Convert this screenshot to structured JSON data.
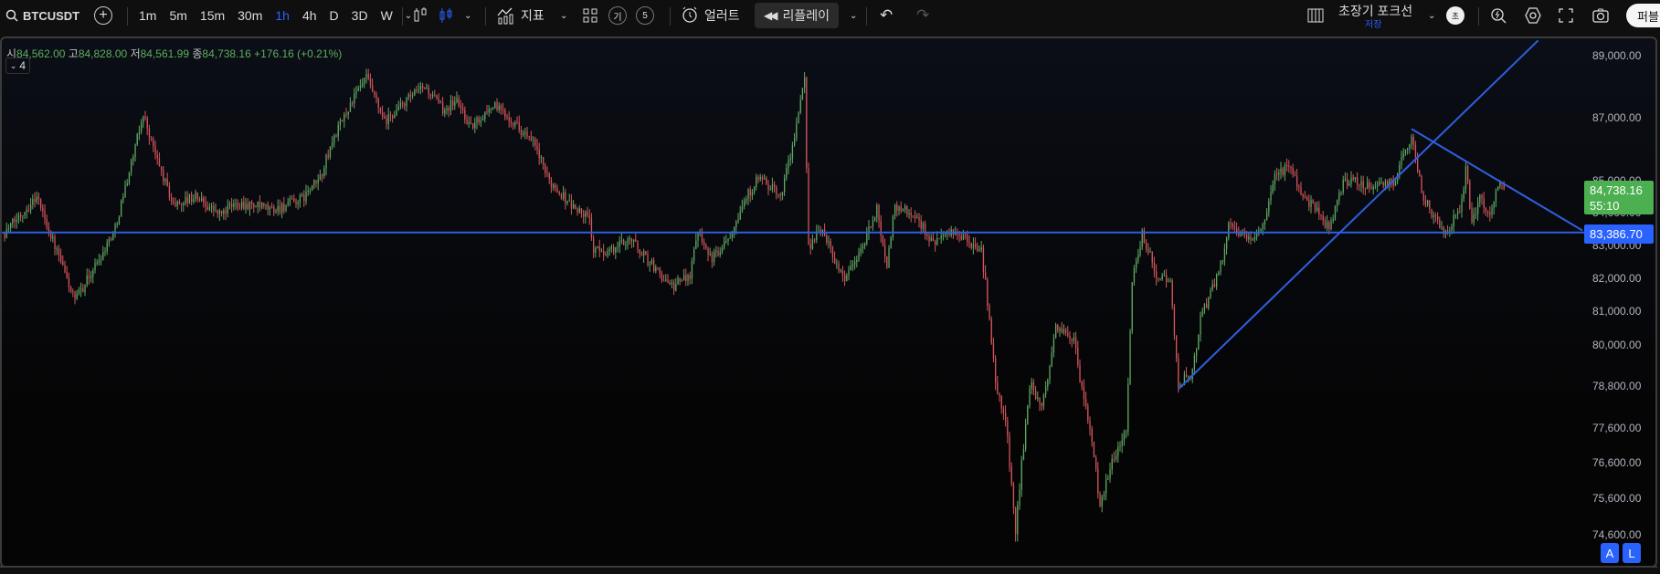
{
  "toolbar": {
    "symbol": "BTCUSDT",
    "intervals": [
      "1m",
      "5m",
      "15m",
      "30m",
      "1h",
      "4h",
      "D",
      "3D",
      "W"
    ],
    "active_interval": "1h",
    "indicators_label": "지표",
    "badge_1": "기",
    "badge_2": "5",
    "alert_label": "얼러트",
    "replay_label": "리플레이",
    "layout_name": "초장기 포크선",
    "save_status": "저장",
    "avatar_letter": "초",
    "publish_label": "퍼블"
  },
  "legend": {
    "open_label": "시",
    "open": "84,562.00",
    "high_label": "고",
    "high": "84,828.00",
    "low_label": "저",
    "low": "84,561.99",
    "close_label": "종",
    "close": "84,738.16",
    "change": "+176.16 (+0.21%)",
    "collapse_count": "4"
  },
  "price_axis": {
    "last_price": "84,738.16",
    "countdown": "55:10",
    "line_price": "83,386.70",
    "buttons": [
      "A",
      "L"
    ]
  },
  "colors": {
    "up": "#5fa862",
    "down": "#d4555a",
    "drawing": "#2f5fe0",
    "last_bg": "#4caf50",
    "line_bg": "#2962ff"
  },
  "chart_data": {
    "type": "candlestick",
    "symbol": "BTCUSDT",
    "interval": "1h",
    "scale": "log",
    "ylim": [
      74600,
      89000
    ],
    "y_ticks": [
      89000,
      87000,
      85000,
      84000,
      83000,
      82000,
      81000,
      80000,
      78800,
      77600,
      76600,
      75600,
      74600
    ],
    "bar_count": 747,
    "close_path": [
      [
        0,
        83380
      ],
      [
        16,
        84509
      ],
      [
        25,
        82961
      ],
      [
        35,
        81305
      ],
      [
        48,
        82682
      ],
      [
        55,
        83520
      ],
      [
        64,
        85797
      ],
      [
        69,
        87105
      ],
      [
        75,
        85797
      ],
      [
        84,
        84225
      ],
      [
        95,
        84509
      ],
      [
        107,
        83942
      ],
      [
        116,
        84310
      ],
      [
        134,
        84083
      ],
      [
        148,
        84423
      ],
      [
        157,
        85079
      ],
      [
        164,
        86376
      ],
      [
        173,
        87546
      ],
      [
        180,
        88285
      ],
      [
        189,
        86813
      ],
      [
        200,
        87546
      ],
      [
        209,
        87988
      ],
      [
        218,
        87252
      ],
      [
        225,
        87546
      ],
      [
        232,
        86668
      ],
      [
        243,
        87399
      ],
      [
        252,
        86959
      ],
      [
        264,
        86086
      ],
      [
        270,
        85079
      ],
      [
        282,
        84225
      ],
      [
        291,
        83801
      ],
      [
        293,
        82821
      ],
      [
        302,
        82821
      ],
      [
        311,
        83240
      ],
      [
        320,
        82543
      ],
      [
        332,
        81716
      ],
      [
        341,
        82129
      ],
      [
        345,
        83520
      ],
      [
        352,
        82543
      ],
      [
        361,
        83380
      ],
      [
        368,
        84367
      ],
      [
        375,
        85079
      ],
      [
        386,
        84509
      ],
      [
        393,
        86376
      ],
      [
        398,
        88136
      ],
      [
        400,
        82961
      ],
      [
        407,
        83520
      ],
      [
        414,
        82405
      ],
      [
        418,
        81991
      ],
      [
        427,
        82961
      ],
      [
        434,
        84083
      ],
      [
        439,
        82405
      ],
      [
        443,
        84225
      ],
      [
        452,
        83942
      ],
      [
        459,
        83380
      ],
      [
        461,
        83101
      ],
      [
        473,
        83380
      ],
      [
        486,
        82821
      ],
      [
        490,
        80760
      ],
      [
        493,
        78885
      ],
      [
        498,
        77828
      ],
      [
        503,
        74753
      ],
      [
        510,
        78885
      ],
      [
        516,
        78090
      ],
      [
        523,
        80489
      ],
      [
        532,
        80219
      ],
      [
        535,
        78885
      ],
      [
        541,
        77307
      ],
      [
        545,
        75256
      ],
      [
        550,
        76532
      ],
      [
        558,
        77567
      ],
      [
        561,
        81853
      ],
      [
        566,
        83380
      ],
      [
        573,
        82129
      ],
      [
        580,
        81853
      ],
      [
        584,
        78885
      ],
      [
        591,
        79150
      ],
      [
        595,
        80760
      ],
      [
        602,
        81853
      ],
      [
        607,
        82821
      ],
      [
        609,
        83801
      ],
      [
        618,
        83101
      ],
      [
        627,
        83660
      ],
      [
        632,
        85079
      ],
      [
        639,
        85510
      ],
      [
        645,
        84651
      ],
      [
        652,
        84083
      ],
      [
        659,
        83520
      ],
      [
        666,
        84936
      ],
      [
        675,
        84936
      ],
      [
        680,
        84793
      ],
      [
        691,
        84936
      ],
      [
        700,
        86463
      ],
      [
        705,
        84651
      ],
      [
        711,
        83801
      ],
      [
        718,
        83380
      ],
      [
        725,
        84310
      ],
      [
        727,
        85424
      ],
      [
        730,
        83660
      ],
      [
        734,
        84509
      ],
      [
        739,
        83942
      ],
      [
        743,
        84936
      ],
      [
        746,
        84738.16
      ]
    ],
    "drawings": {
      "horizontal_line": 83386.7,
      "ascending_trendline": [
        [
          584,
          78710
        ],
        [
          763,
          89500
        ]
      ],
      "descending_trendline": [
        [
          700,
          86630
        ],
        [
          785,
          83450
        ]
      ]
    }
  }
}
